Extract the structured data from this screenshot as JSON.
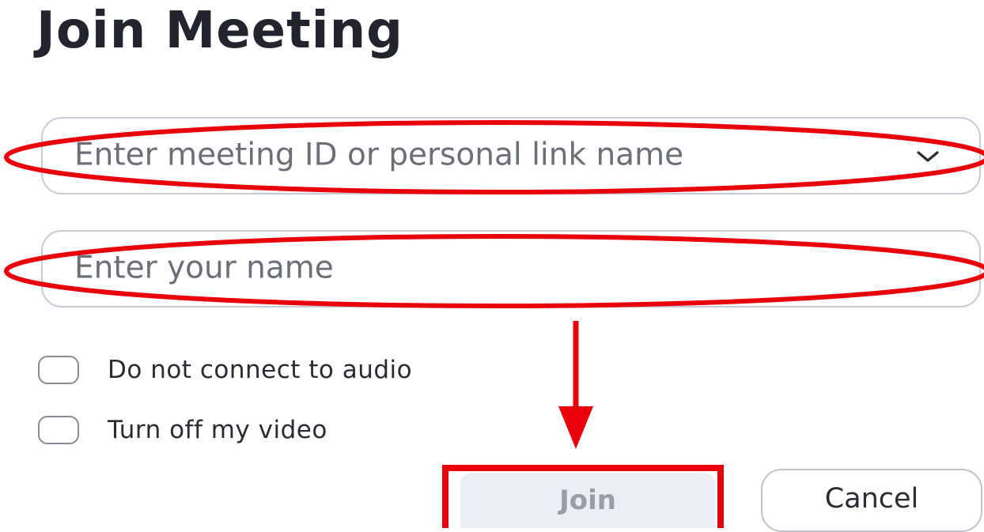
{
  "dialog": {
    "title": "Join Meeting"
  },
  "meeting_id_field": {
    "placeholder": "Enter meeting ID or personal link name",
    "value": "",
    "icon": "chevron-down-icon"
  },
  "name_field": {
    "placeholder": "Enter your name",
    "value": ""
  },
  "options": [
    {
      "label": "Do not connect to audio",
      "checked": false
    },
    {
      "label": "Turn off my video",
      "checked": false
    }
  ],
  "buttons": {
    "join_label": "Join",
    "cancel_label": "Cancel"
  },
  "annotation_color": "#e8000b"
}
